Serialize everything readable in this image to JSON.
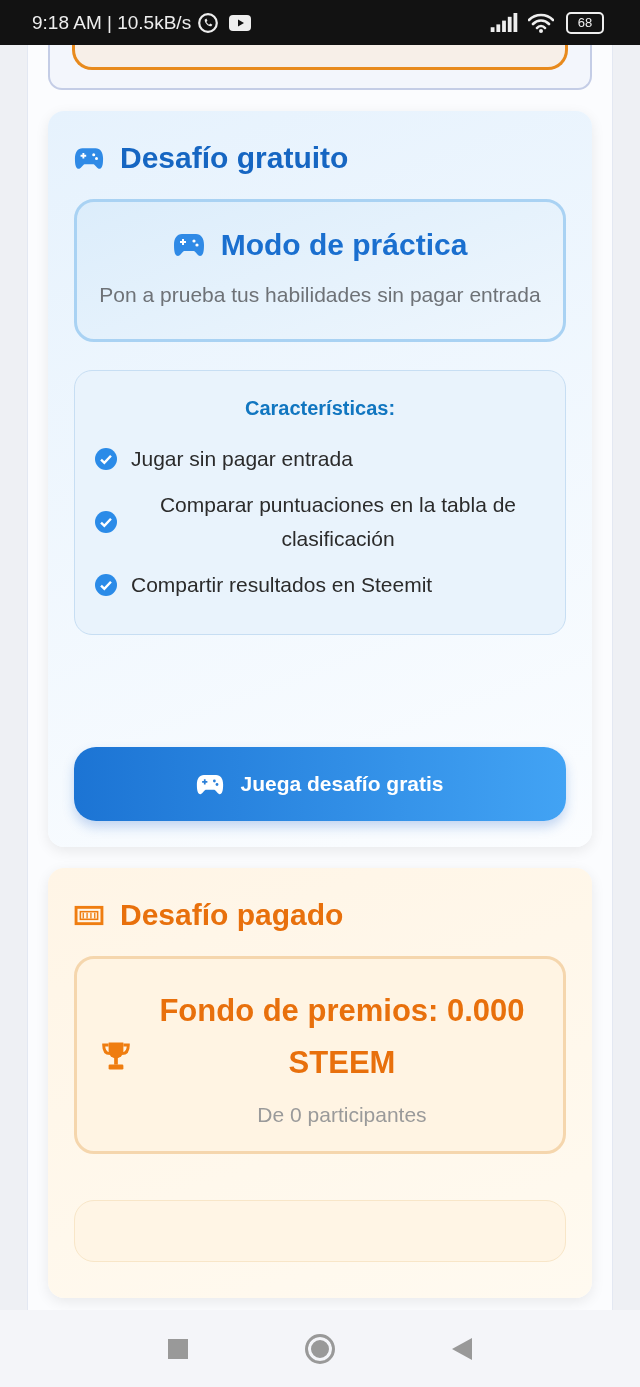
{
  "status_bar": {
    "time_speed": "9:18 AM | 10.5kB/s",
    "battery": "68"
  },
  "free_challenge": {
    "title": "Desafío gratuito",
    "practice_box": {
      "title": "Modo de práctica",
      "description": "Pon a prueba tus habilidades sin pagar entrada"
    },
    "features": {
      "heading": "Características:",
      "items": [
        {
          "text": "Jugar sin pagar entrada"
        },
        {
          "text": "Comparar puntuaciones en la tabla de clasificación"
        },
        {
          "text": "Compartir resultados en Steemit"
        }
      ]
    },
    "button": "Juega desafío gratis"
  },
  "paid_challenge": {
    "title": "Desafío pagado",
    "prize_box": {
      "amount": "Fondo de premios: 0.000 STEEM",
      "participants": "De 0 participantes"
    }
  }
}
